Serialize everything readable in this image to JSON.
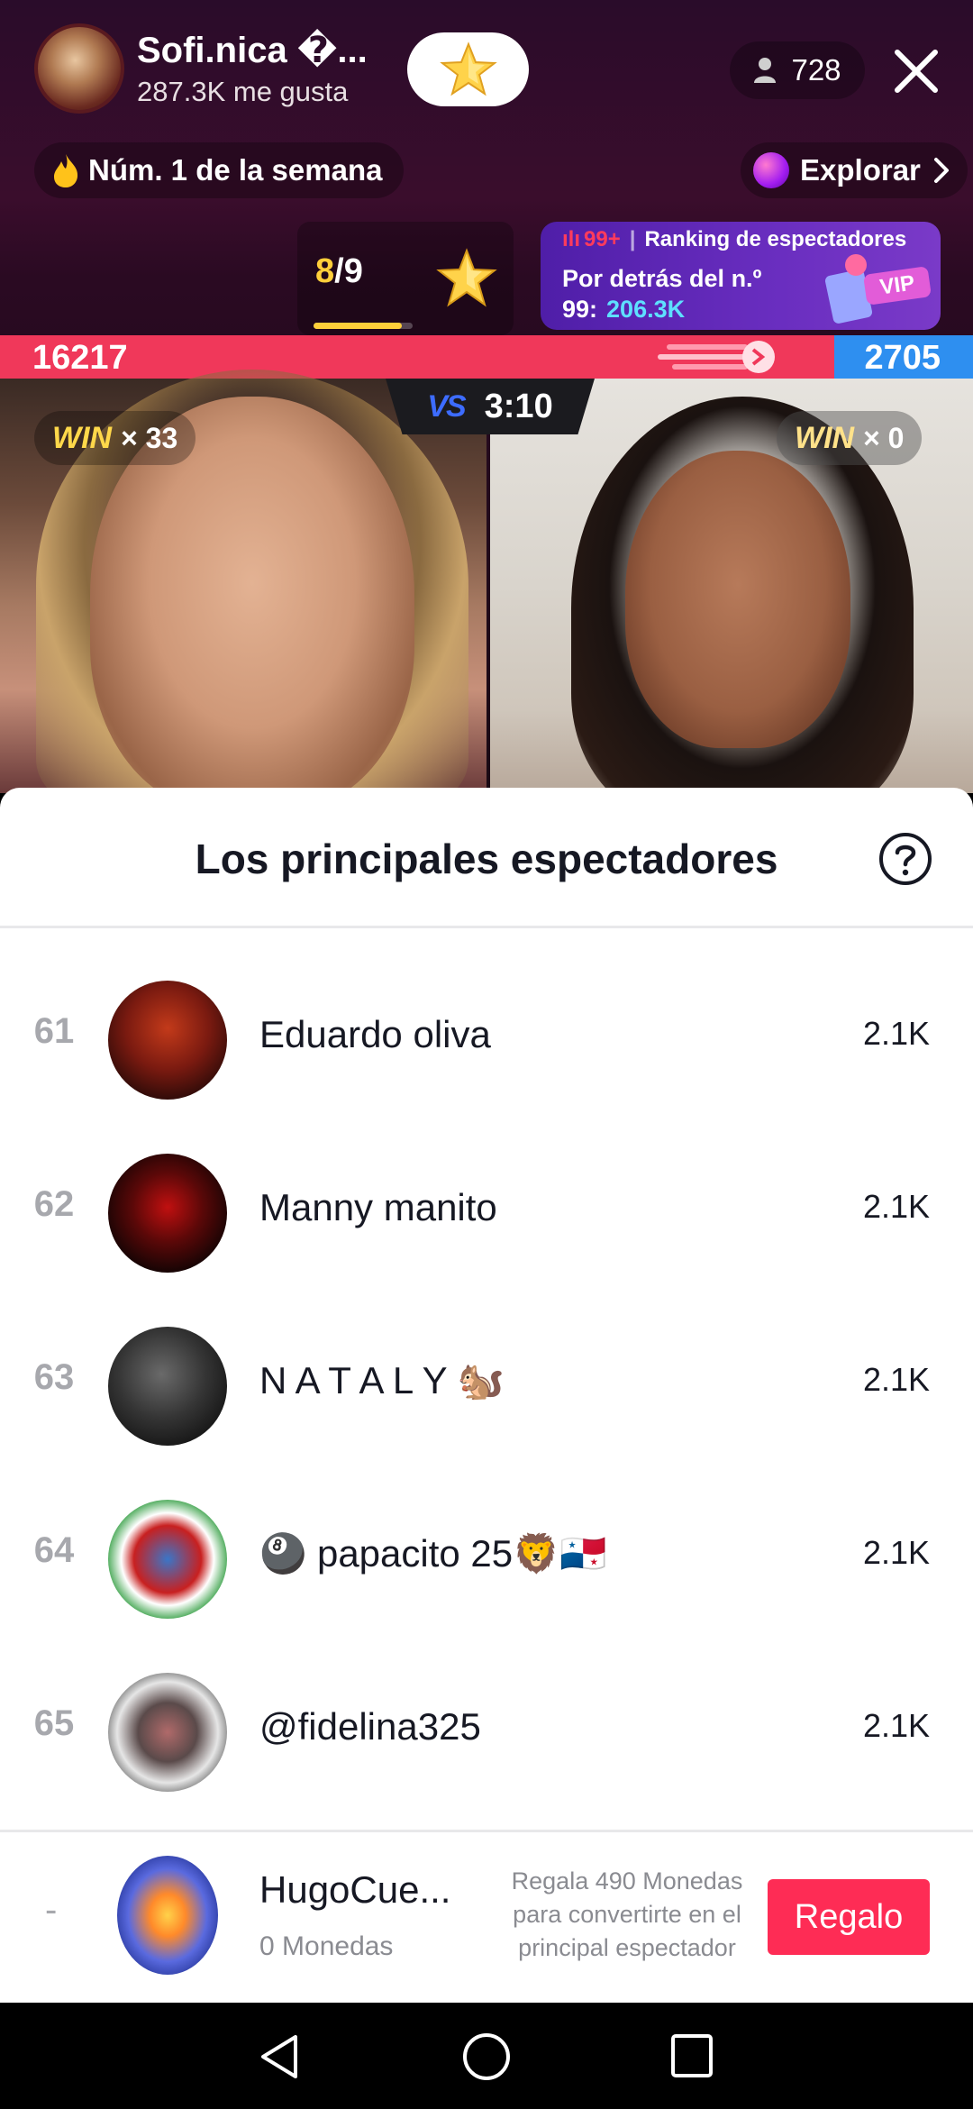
{
  "host": {
    "name": "Sofi.nica �...",
    "likes": "287.3K me gusta"
  },
  "viewers": {
    "count": "728"
  },
  "rank_badge": {
    "label": "Núm. 1 de la semana"
  },
  "explore": {
    "label": "Explorar"
  },
  "task": {
    "current": "8",
    "separator": "/",
    "total": "9",
    "progress": 0.889
  },
  "ranking": {
    "bars": "ılı",
    "badge": "99+",
    "separator": "|",
    "title": "Ranking de espectadores",
    "line1": "Por detrás del n.º",
    "line2_prefix": "99:",
    "line2_value": "206.3K"
  },
  "battle": {
    "score_left": "16217",
    "score_right": "2705",
    "vs": "VS",
    "timer": "3:10",
    "win_left": {
      "label": "WIN",
      "count": "× 33"
    },
    "win_right": {
      "label": "WIN",
      "count": "× 0"
    }
  },
  "sheet": {
    "title": "Los principales espectadores",
    "rows": [
      {
        "rank": "61",
        "name": "Eduardo oliva",
        "score": "2.1K"
      },
      {
        "rank": "62",
        "name": "Manny manito",
        "score": "2.1K"
      },
      {
        "rank": "63",
        "name": "N A T A L Y 🐿️",
        "score": "2.1K"
      },
      {
        "rank": "64",
        "name": "🎱 papacito 25🦁🇵🇦",
        "score": "2.1K"
      },
      {
        "rank": "65",
        "name": "@fidelina325",
        "score": "2.1K"
      }
    ]
  },
  "me": {
    "rank": "-",
    "name": "HugoCue...",
    "coins": "0 Monedas",
    "hint": "Regala 490 Monedas para convertirte en el principal espectador",
    "gift_label": "Regalo"
  },
  "colors": {
    "accent": "#fe2c55",
    "score_red": "#f0385a",
    "score_blue": "#2e8ff0",
    "gold": "#ffcf3a"
  }
}
